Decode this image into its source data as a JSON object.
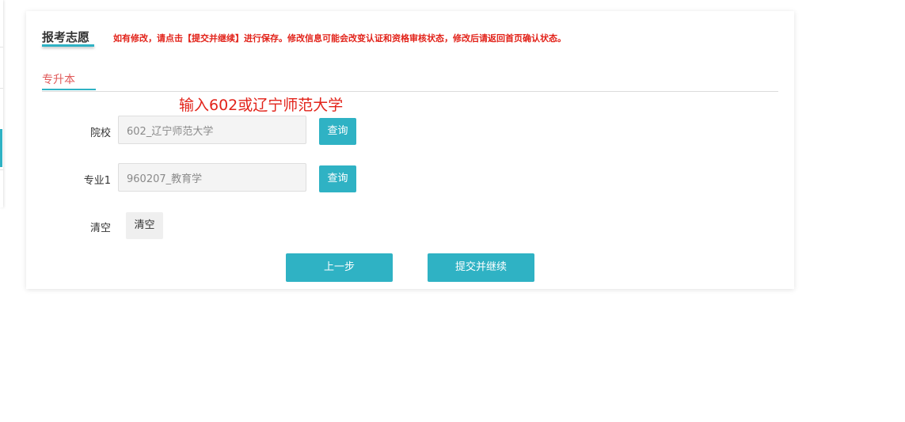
{
  "page": {
    "title": "报考志愿",
    "notice": "如有修改，请点击【提交并继续】进行保存。修改信息可能会改变认证和资格审核状态，修改后请返回首页确认状态。"
  },
  "tabs": [
    {
      "label": "专升本",
      "active": true
    }
  ],
  "hint": "输入602或辽宁师范大学",
  "form": {
    "school": {
      "label": "院校",
      "value": "602_辽宁师范大学",
      "query_label": "查询"
    },
    "major1": {
      "label": "专业1",
      "value": "960207_教育学",
      "query_label": "查询"
    },
    "clear": {
      "label": "清空",
      "button_label": "清空"
    }
  },
  "actions": {
    "prev_label": "上一步",
    "submit_label": "提交并继续"
  },
  "colors": {
    "accent": "#2fb2c4",
    "notice": "#e2231a",
    "tab_text": "#e05a5a"
  }
}
